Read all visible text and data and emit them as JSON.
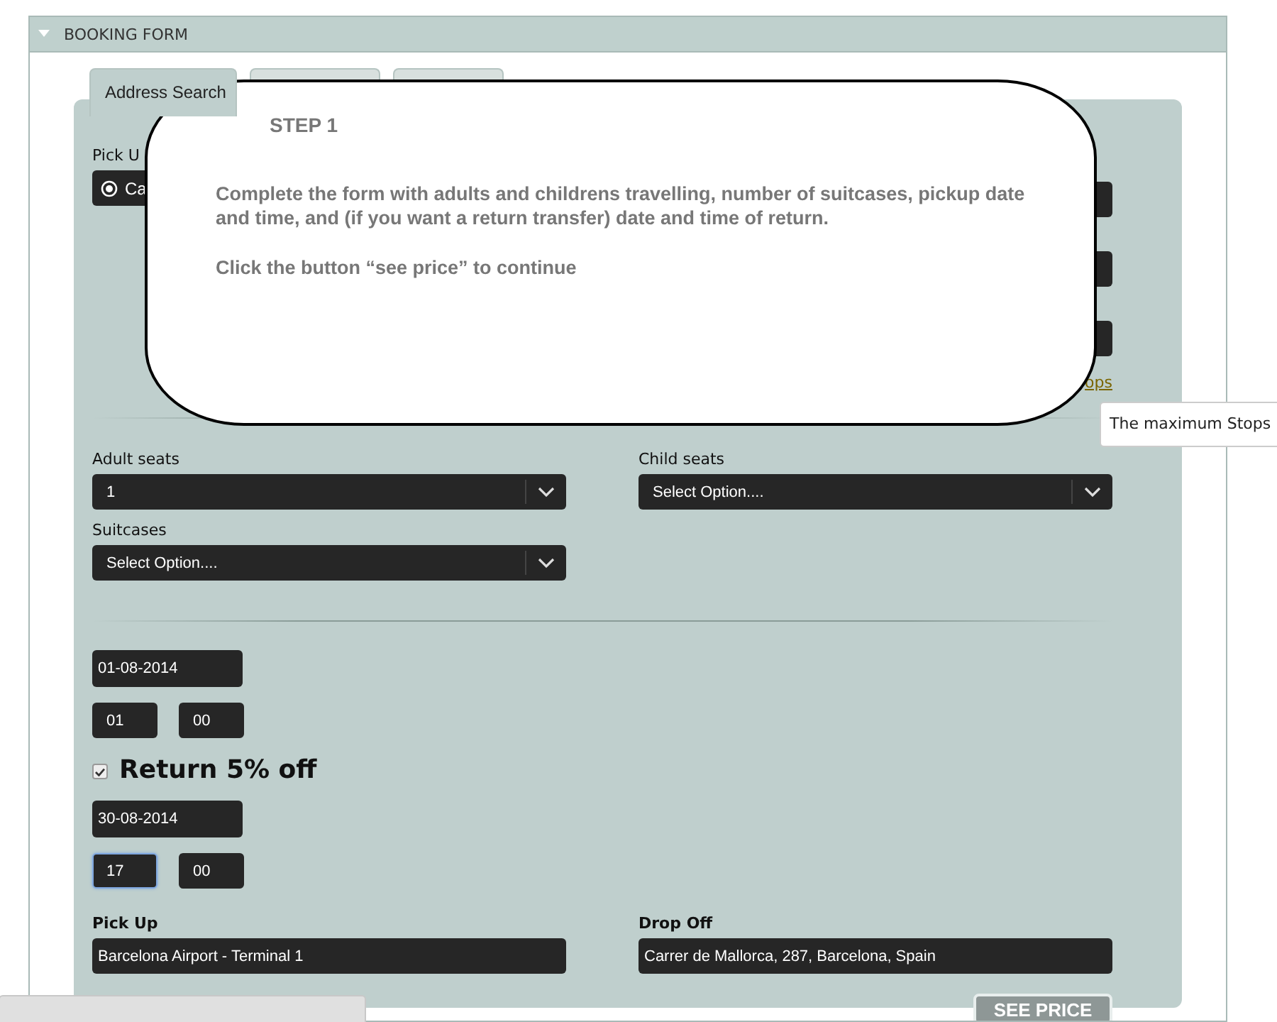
{
  "panel": {
    "title": "BOOKING FORM",
    "expanded": true
  },
  "tabs": [
    {
      "label": "Address Search",
      "selected": true
    },
    {
      "selected": false
    },
    {
      "selected": false
    }
  ],
  "pickup": {
    "label": "Pick U",
    "locate_button": "Ca"
  },
  "stops_link": "ops",
  "seats": [
    {
      "label": "Adult seats",
      "value": "1"
    },
    {
      "label": "Child seats",
      "value": "Select Option...."
    },
    {
      "label": "Suitcases",
      "value": "Select Option...."
    }
  ],
  "outbound": {
    "date": "01-08-2014",
    "hour": "01",
    "minute": "00"
  },
  "return": {
    "checked": true,
    "label": "Return 5% off",
    "date": "30-08-2014",
    "hour": "17",
    "minute": "00",
    "hour_focused": true
  },
  "route": [
    {
      "label": "Pick Up",
      "value": "Barcelona Airport - Terminal 1"
    },
    {
      "label": "Drop Off",
      "value": "Carrer de Mallorca, 287, Barcelona, Spain"
    }
  ],
  "see_price": {
    "label": "SEE PRICE",
    "disabled": true
  },
  "callout": {
    "title": "STEP 1",
    "paragraphs": [
      "Complete the form with adults and childrens travelling, number of suitcases, pickup date and time, and (if you want a return transfer) date and time of return.",
      "Click the button “see price” to continue"
    ]
  },
  "tooltip": "The maximum Stops"
}
